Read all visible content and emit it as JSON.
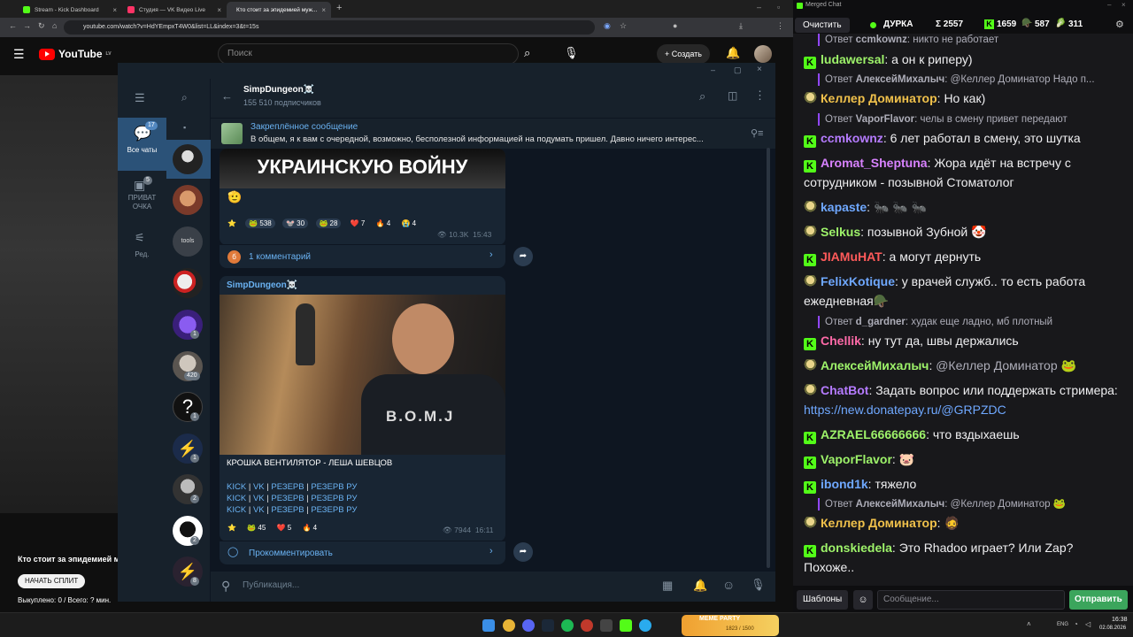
{
  "browser": {
    "tabs": [
      {
        "label": "Stream - Kick Dashboard",
        "color": "#53fc18"
      },
      {
        "label": "Студия — VK Видео Live",
        "color": "#ff3366"
      },
      {
        "label": "Кто стоит за эпидемией муж...",
        "color": "#ff0000"
      }
    ],
    "url": "youtube.com/watch?v=HdYEmpxT4W0&list=LL&index=3&t=15s"
  },
  "youtube": {
    "logo": "YouTube",
    "logo_sup": "LV",
    "search_placeholder": "Поиск",
    "create_label": "Создать",
    "video_title": "Кто стоит за эпидемией му",
    "split_button": "НАЧАТЬ СПЛИТ",
    "split_status": "Выкуплено: 0 / Всего: ? мин."
  },
  "telegram": {
    "folders": [
      {
        "label": "Все чаты",
        "badge": "17"
      },
      {
        "label": "ПРИВАТ ОЧКА",
        "badge": "5"
      },
      {
        "label": "Ред.",
        "badge": ""
      }
    ],
    "chat_badges": [
      "",
      "",
      "",
      "",
      "1",
      "420",
      "1",
      "1",
      "2",
      "2",
      "8"
    ],
    "channel_name": "SimpDungeon☠️",
    "subscribers": "155 510 подписчиков",
    "pinned_title": "Закреплённое сообщение",
    "pinned_text": "В общем, я к вам с очередной, возможно, бесполезной информацией на подумать пришел.  Давно ничего интерес...",
    "msg1": {
      "image_caption": "УКРАИНСКУЮ ВОЙНУ",
      "reactions": [
        {
          "emoji": "⭐",
          "count": ""
        },
        {
          "emoji": "🐸",
          "count": "538"
        },
        {
          "emoji": "🐭",
          "count": "30"
        },
        {
          "emoji": "🐸",
          "count": "28"
        },
        {
          "emoji": "❤️",
          "count": "7"
        },
        {
          "emoji": "🔥",
          "count": "4"
        },
        {
          "emoji": "😭",
          "count": "4"
        }
      ],
      "views": "10.3K",
      "time": "15:43",
      "comments": "1 комментарий",
      "comments_avatar": "б"
    },
    "msg2": {
      "author": "SimpDungeon☠️",
      "shirt_text": "B.O.M.J",
      "title": "КРОШКА ВЕНТИЛЯТОР - ЛЕША ШЕВЦОВ",
      "links": [
        "KICK",
        "VK",
        "РЕЗЕРВ",
        "РЕЗЕРВ РУ"
      ],
      "reactions": [
        {
          "emoji": "⭐",
          "count": ""
        },
        {
          "emoji": "🐸",
          "count": "45"
        },
        {
          "emoji": "❤️",
          "count": "5"
        },
        {
          "emoji": "🔥",
          "count": "4"
        }
      ],
      "views": "7944",
      "time": "16:11",
      "comment_cta": "Прокомментировать"
    },
    "compose_placeholder": "Публикация..."
  },
  "chat": {
    "window_title": "Merged Chat",
    "clear_label": "Очистить",
    "status_name": "ДУРКА",
    "stats": [
      {
        "icon": "sigma",
        "value": "Σ 2557"
      },
      {
        "icon": "kick",
        "value": "1659"
      },
      {
        "icon": "twitch",
        "value": "587"
      },
      {
        "icon": "vk",
        "value": "311"
      }
    ],
    "messages": [
      {
        "type": "reply",
        "to": "ccmkownz",
        "text": "никто не работает"
      },
      {
        "type": "msg",
        "src": "kick",
        "user": "ludawersal",
        "color": "#9ef36a",
        "text": "а он к риперу)"
      },
      {
        "type": "reply",
        "to": "АлексейМихалыч",
        "text": "@Келлер Доминатор Надо п..."
      },
      {
        "type": "msg",
        "src": "twitch",
        "user": "Келлер Доминатор",
        "color": "#f0c14b",
        "text": "Но как)"
      },
      {
        "type": "reply",
        "to": "VaporFlavor",
        "text": "челы в смену привет передают"
      },
      {
        "type": "msg",
        "src": "kick",
        "user": "ccmkownz",
        "color": "#b57bff",
        "text": "6 лет работал в смену, это шутка"
      },
      {
        "type": "msg",
        "src": "kick",
        "user": "Aromat_Sheptuna",
        "color": "#d882ff",
        "text": "Жора идёт на встречу с сотрудником - позывной Стоматолог"
      },
      {
        "type": "msg",
        "src": "twitch",
        "user": "kapaste",
        "color": "#6fa8ff",
        "text": "🐜 🐜 🐜"
      },
      {
        "type": "msg",
        "src": "twitch",
        "user": "Selkus",
        "color": "#9ef36a",
        "text": "позывной Зубной 🤡"
      },
      {
        "type": "msg",
        "src": "kick",
        "user": "JIAMuHAT",
        "color": "#ff5a5a",
        "text": "а могут дернуть"
      },
      {
        "type": "msg",
        "src": "twitch",
        "user": "FelixKotique",
        "color": "#6fa8ff",
        "text": "у врачей служб.. то есть работа ежедневная🪖"
      },
      {
        "type": "reply",
        "to": "d_gardner",
        "text": "худак еще ладно, мб плотный"
      },
      {
        "type": "msg",
        "src": "kick",
        "user": "Chellik",
        "color": "#ff6aa8",
        "text": "ну тут да, швы держались"
      },
      {
        "type": "msg",
        "src": "twitch",
        "user": "АлексейМихалыч",
        "color": "#9ef36a",
        "text": "@Келлер Доминатор 🐸"
      },
      {
        "type": "msg",
        "src": "twitch",
        "user": "ChatBot",
        "color": "#b57bff",
        "text": "Задать вопрос или поддержать стримера:",
        "link": "https://new.donatepay.ru/@GRPZDC"
      },
      {
        "type": "msg",
        "src": "kick",
        "user": "AZRAEL66666666",
        "color": "#9ef36a",
        "text": "что вздыхаешь"
      },
      {
        "type": "msg",
        "src": "kick",
        "user": "VaporFlavor",
        "color": "#9ef36a",
        "text": "🐷"
      },
      {
        "type": "msg",
        "src": "kick",
        "user": "ibond1k",
        "color": "#6fa8ff",
        "text": "тяжело"
      },
      {
        "type": "reply",
        "to": "АлексейМихалыч",
        "text": "@Келлер Доминатор 🐸"
      },
      {
        "type": "msg",
        "src": "twitch",
        "user": "Келлер Доминатор",
        "color": "#f0c14b",
        "text": "🧔"
      },
      {
        "type": "msg",
        "src": "kick",
        "user": "donskiedela",
        "color": "#9ef36a",
        "text": "Это Rhadoo играет? Или Zap? Похоже.."
      }
    ],
    "templates_label": "Шаблоны",
    "input_placeholder": "Сообщение...",
    "send_label": "Отправить"
  },
  "taskbar": {
    "widget_label": "MEME PARTY",
    "widget_value": "1823 / 1500",
    "lang": "ENG",
    "time": "16:38",
    "date": "02.08.2026"
  }
}
